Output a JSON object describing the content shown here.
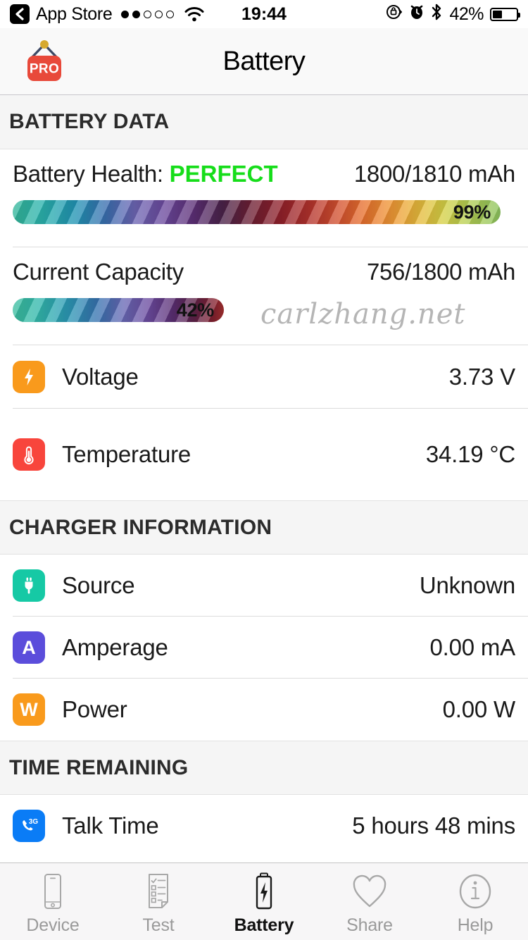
{
  "status_bar": {
    "back_label": "App Store",
    "back_icon": "chevron-left-icon",
    "signal_dots_filled": 2,
    "signal_dots_total": 5,
    "wifi_icon": "wifi-icon",
    "time": "19:44",
    "rotation_lock_icon": "rotation-lock-icon",
    "alarm_icon": "alarm-clock-icon",
    "bluetooth_icon": "bluetooth-icon",
    "battery_percent": "42%",
    "battery_fill_ratio": 0.42
  },
  "nav_bar": {
    "title": "Battery",
    "pro_badge_label": "PRO",
    "pro_badge_color": "#e8493a",
    "pro_badge_nail_color": "#d6a92f",
    "pro_badge_string_color": "#3e4a66"
  },
  "sections": [
    {
      "id": "battery-data",
      "title": "BATTERY DATA"
    },
    {
      "id": "charger-information",
      "title": "CHARGER INFORMATION"
    },
    {
      "id": "time-remaining",
      "title": "TIME REMAINING"
    }
  ],
  "battery_data": {
    "health": {
      "label": "Battery Health: ",
      "status": "PERFECT",
      "status_color": "#16dd1a",
      "value": "1800/1810 mAh",
      "percent_label": "99%",
      "percent": 99
    },
    "capacity": {
      "label": "Current Capacity",
      "value": "756/1800 mAh",
      "percent_label": "42%",
      "percent": 42
    },
    "rows": [
      {
        "label": "Voltage",
        "value": "3.73 V",
        "icon": "lightning-bolt-icon",
        "icon_color": "#f99a1c"
      },
      {
        "label": "Temperature",
        "value": "34.19 °C",
        "icon": "thermometer-icon",
        "icon_color": "#f8453c"
      }
    ]
  },
  "charger_information": {
    "rows": [
      {
        "label": "Source",
        "value": "Unknown",
        "icon": "power-plug-icon",
        "icon_color": "#16c9a5"
      },
      {
        "label": "Amperage",
        "value": "0.00 mA",
        "icon": "amperage-letter-icon",
        "icon_letter": "A",
        "icon_color": "#5b4ddb"
      },
      {
        "label": "Power",
        "value": "0.00 W",
        "icon": "power-letter-icon",
        "icon_letter": "W",
        "icon_color": "#f99a1c"
      }
    ]
  },
  "time_remaining": {
    "rows": [
      {
        "label": "Talk Time",
        "value": "5 hours 48 mins",
        "icon": "phone-3g-icon",
        "icon_color": "#0a7cf6"
      }
    ]
  },
  "watermark": "carlzhang.net",
  "tab_bar": {
    "tabs": [
      {
        "label": "Device",
        "icon": "phone-device-icon",
        "active": false
      },
      {
        "label": "Test",
        "icon": "checklist-icon",
        "active": false
      },
      {
        "label": "Battery",
        "icon": "battery-bolt-icon",
        "active": true
      },
      {
        "label": "Share",
        "icon": "heart-icon",
        "active": false
      },
      {
        "label": "Help",
        "icon": "info-circle-icon",
        "active": false
      }
    ]
  }
}
